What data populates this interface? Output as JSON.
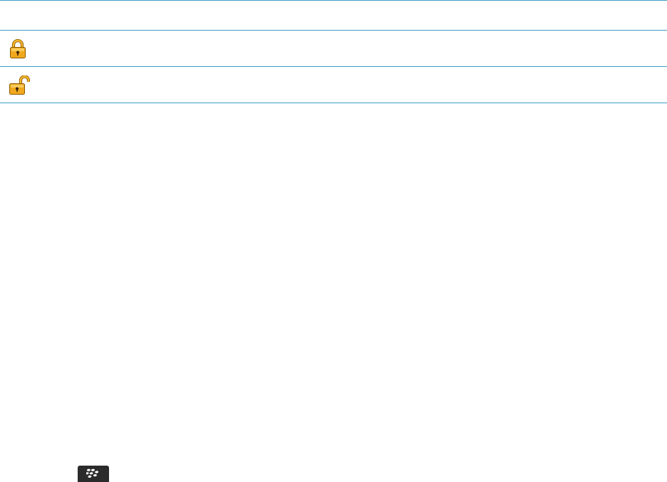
{
  "icons": {
    "locked": "padlock-closed-icon",
    "unlocked": "padlock-open-icon",
    "menu_key": "blackberry-menu-key-icon"
  },
  "colors": {
    "rule": "#3d9fc4",
    "lock_body": "#f0a81e",
    "lock_shackle": "#f0a81e",
    "lock_outline": "#8a5a00",
    "key_bg": "#2b2b2b"
  }
}
